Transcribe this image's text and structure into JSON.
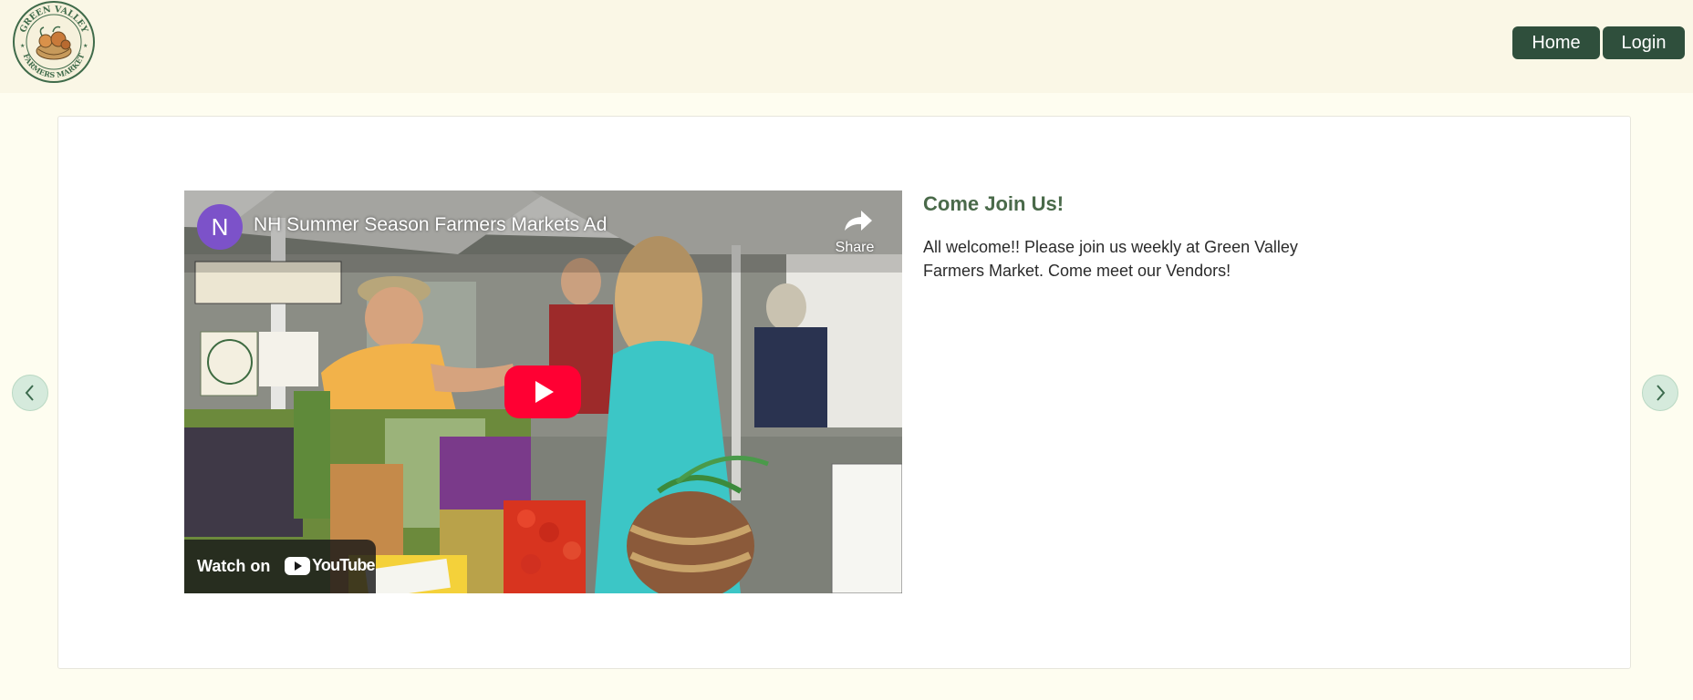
{
  "header": {
    "logo": {
      "top_text": "GREEN VALLEY",
      "bottom_text": "FARMERS MARKET"
    },
    "nav": {
      "home_label": "Home",
      "login_label": "Login"
    }
  },
  "carousel": {
    "slide": {
      "video": {
        "channel_initial": "N",
        "title": "NH Summer Season Farmers Markets Ad",
        "share_label": "Share",
        "watch_on_label": "Watch on",
        "youtube_label": "YouTube"
      },
      "heading": "Come Join Us!",
      "body": "All welcome!! Please join us weekly at Green Valley Farmers Market. Come meet our Vendors!"
    },
    "prev_icon": "chevron-left-icon",
    "next_icon": "chevron-right-icon"
  },
  "colors": {
    "page_background": "#fefdf0",
    "header_background": "#faf7e6",
    "nav_button": "#2f4f3c",
    "heading": "#4a6a4a",
    "youtube_red": "#ff0033",
    "arrow_background": "#d5eadc"
  }
}
